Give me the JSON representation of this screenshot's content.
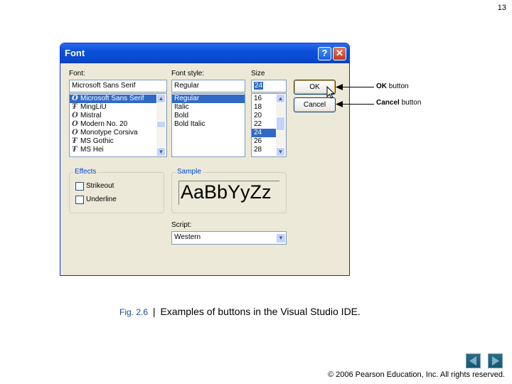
{
  "page_number": "13",
  "dialog": {
    "title": "Font",
    "help_label": "?",
    "close_label": "✕",
    "font_label": "Font:",
    "font_style_label": "Font style:",
    "size_label": "Size",
    "font_value": "Microsoft Sans Serif",
    "style_value": "Regular",
    "size_value": "24",
    "fonts": [
      "Microsoft Sans Serif",
      "MingLiU",
      "Mistral",
      "Modern No. 20",
      "Monotype Corsiva",
      "MS Gothic",
      "MS Hei"
    ],
    "font_glyphs": [
      "O",
      "Ŧ",
      "O",
      "O",
      "O",
      "Ŧ",
      "Ŧ"
    ],
    "styles": [
      "Regular",
      "Italic",
      "Bold",
      "Bold Italic"
    ],
    "sizes": [
      "16",
      "18",
      "20",
      "22",
      "24",
      "26",
      "28"
    ],
    "ok_label": "OK",
    "cancel_label": "Cancel",
    "effects_label": "Effects",
    "strikeout_label": "Strikeout",
    "underline_label": "Underline",
    "sample_label": "Sample",
    "sample_text": "AaBbYyZz",
    "script_label": "Script:",
    "script_value": "Western"
  },
  "callouts": {
    "ok_bold": "OK",
    "ok_rest": " button",
    "cancel_bold": "Cancel",
    "cancel_rest": " button"
  },
  "caption": {
    "fig_num": "Fig. 2.6",
    "separator": "|",
    "text": "Examples of buttons in the Visual Studio IDE."
  },
  "copyright": "© 2006 Pearson Education, Inc.  All rights reserved.",
  "icons": {
    "help": "help-icon",
    "close": "close-icon",
    "prev": "prev-arrow-icon",
    "next": "next-arrow-icon",
    "cursor": "mouse-cursor-icon"
  }
}
